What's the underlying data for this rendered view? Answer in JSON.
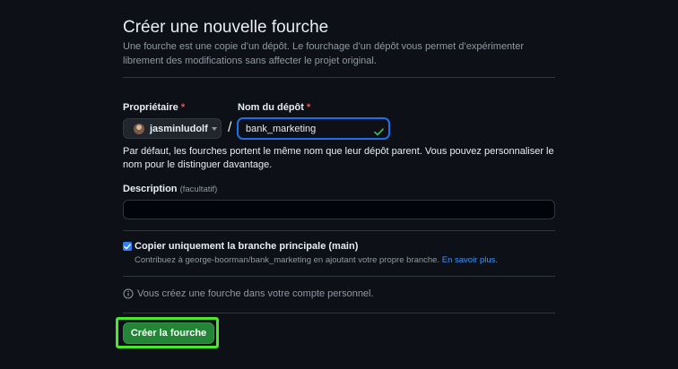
{
  "header": {
    "title": "Créer une nouvelle fourche",
    "subtitle": "Une fourche est une copie d’un dépôt. Le fourchage d’un dépôt vous permet d’expérimenter librement des modifications sans affecter le projet original."
  },
  "owner": {
    "label": "Propriétaire",
    "required_mark": "*",
    "selected": "jasminludolf"
  },
  "repo": {
    "label": "Nom du dépôt",
    "required_mark": "*",
    "separator": "/",
    "value": "bank_marketing",
    "valid": true
  },
  "help_text": "Par défaut, les fourches portent le même nom que leur dépôt parent. Vous pouvez personnaliser le nom pour le distinguer davantage.",
  "description": {
    "label": "Description",
    "optional": "(facultatif)",
    "value": ""
  },
  "copy_branch": {
    "checked": true,
    "label": "Copier uniquement la branche principale (main)",
    "help": "Contribuez à george-boorman/bank_marketing en ajoutant votre propre branche.",
    "link": "En savoir plus."
  },
  "info": {
    "text": "Vous créez une fourche dans votre compte personnel."
  },
  "submit": {
    "label": "Créer la fourche"
  },
  "colors": {
    "background": "#0d1117",
    "accent_green": "#238636",
    "focus_blue": "#1f6feb",
    "highlight_green": "#49e82c",
    "link_blue": "#4493f8",
    "required_red": "#f85149"
  }
}
